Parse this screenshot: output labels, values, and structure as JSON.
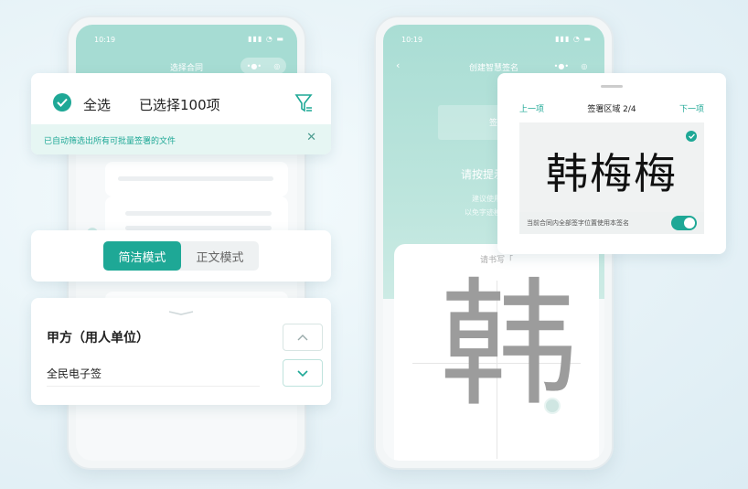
{
  "colors": {
    "accent": "#1ea896",
    "header": "#a6dcd3",
    "notice_bg": "#e6f6f3"
  },
  "phone_left": {
    "status_time": "10:19",
    "nav_title": "选择合同"
  },
  "phone_right": {
    "status_time": "10:19",
    "nav_title": "创建智慧签名",
    "instruction": "请按提示书写",
    "hint_line1": "建议使用楷书",
    "hint_line2": "以免字迹模糊无法",
    "pad_label": "请书写「",
    "preview_char": "韩"
  },
  "select_card": {
    "select_all": "全选",
    "selected_count": "已选择100项",
    "notice": "已自动筛选出所有可批量签署的文件",
    "icons": [
      "check-icon",
      "filter-icon",
      "close-icon"
    ]
  },
  "mode_toggle": {
    "options": [
      "简洁模式",
      "正文模式"
    ],
    "active": "简洁模式"
  },
  "party_card": {
    "title": "甲方（用人单位）",
    "value": "全民电子签"
  },
  "sign_area_card": {
    "prev": "上一项",
    "title": "签署区域 2/4",
    "next": "下一项",
    "signature": "韩梅梅",
    "apply_all": "当前合同内全部签字位置使用本签名",
    "apply_all_enabled": true
  }
}
